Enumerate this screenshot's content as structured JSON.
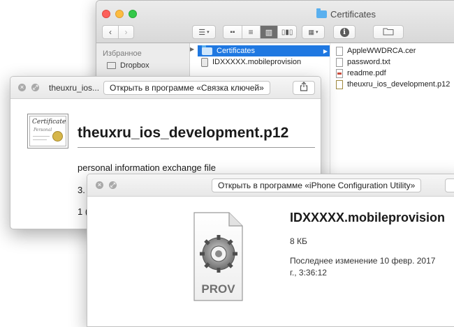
{
  "finder": {
    "title": "Certificates",
    "sidebar": {
      "section": "Избранное",
      "items": [
        {
          "label": "Dropbox",
          "icon": "folder-icon"
        }
      ]
    },
    "column1": [
      {
        "label": "Certificates",
        "selected": true,
        "icon": "folder-icon"
      },
      {
        "label": "IDXXXXX.mobileprovision",
        "selected": false,
        "icon": "prov-file-icon"
      }
    ],
    "column2": [
      {
        "label": "AppleWWDRCA.cer",
        "icon": "cer-file-icon"
      },
      {
        "label": "password.txt",
        "icon": "text-file-icon"
      },
      {
        "label": "readme.pdf",
        "icon": "pdf-file-icon"
      },
      {
        "label": "theuxru_ios_development.p12",
        "icon": "p12-file-icon"
      }
    ]
  },
  "quicklook1": {
    "title": "theuxru_ios...",
    "open_button": "Открыть в программе «Связка ключей»",
    "file_name": "theuxru_ios_development.p12",
    "kind": "personal information exchange file",
    "size_partial": "3.",
    "date_partial": "1 (",
    "icon_text": {
      "line1": "Certificate",
      "line2": "Personal"
    }
  },
  "quicklook2": {
    "open_button": "Открыть в программе «iPhone Configuration Utility»",
    "file_name": "IDXXXXX.mobileprovision",
    "size": "8 КБ",
    "modified_line1": "Последнее изменение 10 февр. 2017",
    "modified_line2": "г., 3:36:12",
    "icon_badge": "PROV"
  },
  "colors": {
    "selection": "#1f78e1",
    "folder": "#5ab0ef",
    "close_red": "#fc605b",
    "minimize_yellow": "#fdbc40",
    "zoom_green": "#34c84a"
  }
}
